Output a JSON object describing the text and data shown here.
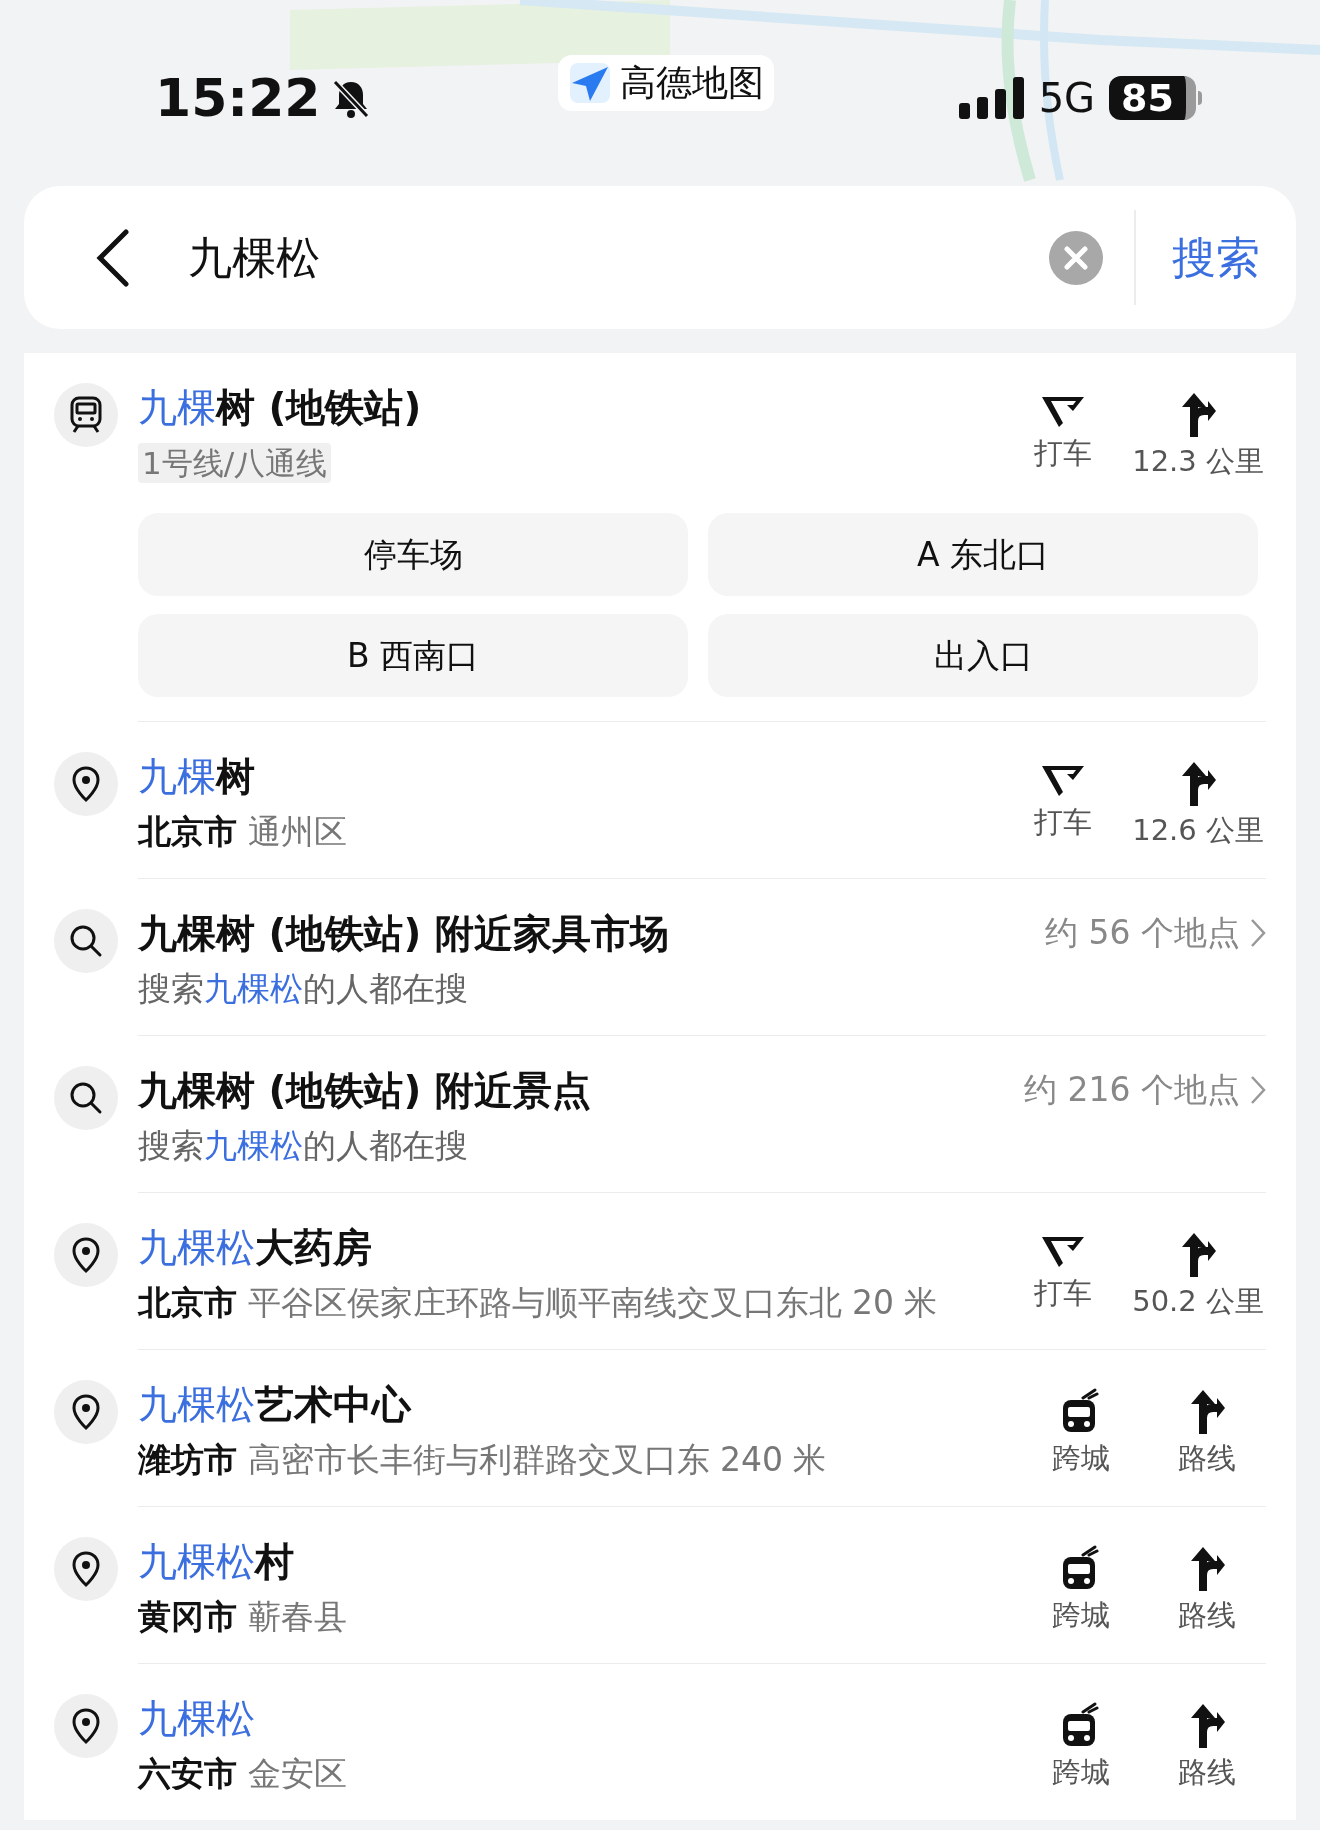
{
  "status_bar": {
    "time": "15:22",
    "app_badge": "高德地图",
    "network": "5G",
    "battery": "85"
  },
  "search": {
    "value": "九棵松",
    "button": "搜索"
  },
  "results": [
    {
      "kind": "station",
      "title_highlight": "九棵",
      "title_rest": "树 (地铁站)",
      "lines": "1号线/八通线",
      "chips": [
        "停车场",
        "A 东北口",
        "B 西南口",
        "出入口"
      ],
      "actions": [
        {
          "kind": "taxi",
          "label": "打车"
        },
        {
          "kind": "route",
          "label": "12.3 公里"
        }
      ]
    },
    {
      "kind": "place",
      "title_highlight": "九棵",
      "title_rest": "树",
      "city": "北京市",
      "address": "通州区",
      "actions": [
        {
          "kind": "taxi",
          "label": "打车"
        },
        {
          "kind": "route",
          "label": "12.6 公里"
        }
      ]
    },
    {
      "kind": "query",
      "title": "九棵树 (地铁站) 附近家具市场",
      "sub_prefix": "搜索",
      "sub_highlight": "九棵松",
      "sub_suffix": "的人都在搜",
      "count": "约 56 个地点"
    },
    {
      "kind": "query",
      "title": "九棵树 (地铁站) 附近景点",
      "sub_prefix": "搜索",
      "sub_highlight": "九棵松",
      "sub_suffix": "的人都在搜",
      "count": "约 216 个地点"
    },
    {
      "kind": "place",
      "title_highlight": "九棵松",
      "title_rest": "大药房",
      "city": "北京市",
      "address": "平谷区侯家庄环路与顺平南线交叉口东北 20 米",
      "actions": [
        {
          "kind": "taxi",
          "label": "打车"
        },
        {
          "kind": "route",
          "label": "50.2 公里"
        }
      ]
    },
    {
      "kind": "place",
      "title_highlight": "九棵松",
      "title_rest": "艺术中心",
      "city": "潍坊市",
      "address": "高密市长丰街与利群路交叉口东 240 米",
      "actions": [
        {
          "kind": "intercity",
          "label": "跨城"
        },
        {
          "kind": "route",
          "label": "路线"
        }
      ]
    },
    {
      "kind": "place",
      "title_highlight": "九棵松",
      "title_rest": "村",
      "city": "黄冈市",
      "address": "蕲春县",
      "actions": [
        {
          "kind": "intercity",
          "label": "跨城"
        },
        {
          "kind": "route",
          "label": "路线"
        }
      ]
    },
    {
      "kind": "place",
      "title_highlight": "九棵松",
      "city": "六安市",
      "address": "金安区",
      "actions": [
        {
          "kind": "intercity",
          "label": "跨城"
        },
        {
          "kind": "route",
          "label": "路线"
        }
      ]
    }
  ]
}
